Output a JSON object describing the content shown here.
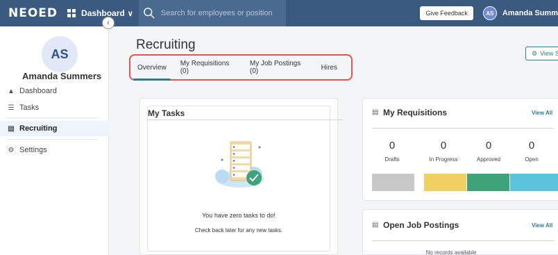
{
  "topbar": {
    "logo": "NEOED",
    "dashboard_label": "Dashboard",
    "search_placeholder": "Search for employees or positions",
    "feedback_label": "Give Feedback",
    "avatar_initials": "AS",
    "user_name": "Amanda Summ"
  },
  "sidebar": {
    "avatar_initials": "AS",
    "user_name": "Amanda Summers",
    "collapse_icon": "chevron-left-icon",
    "items": [
      {
        "label": "Dashboard",
        "icon": "home-icon"
      },
      {
        "label": "Tasks",
        "icon": "list-icon"
      },
      {
        "label": "Recruiting",
        "icon": "document-icon",
        "active": true
      },
      {
        "label": "Settings",
        "icon": "gear-icon"
      }
    ]
  },
  "main": {
    "title": "Recruiting",
    "tabs": [
      {
        "label": "Overview",
        "active": true
      },
      {
        "label": "My Requisitions (0)"
      },
      {
        "label": "My Job Postings (0)"
      },
      {
        "label": "Hires"
      }
    ],
    "view_button": "View S"
  },
  "tasks_card": {
    "title": "My Tasks",
    "message": "You have zero tasks to do!",
    "sub_message": "Check back later for any new tasks."
  },
  "requisitions_card": {
    "title": "My Requisitions",
    "view_all": "View All",
    "stats": [
      {
        "value": "0",
        "label": "Drafts",
        "color": "#c8c8c8"
      },
      {
        "value": "0",
        "label": "In Progress",
        "color": "#f2cf63"
      },
      {
        "value": "0",
        "label": "Approved",
        "color": "#3fa37a"
      },
      {
        "value": "0",
        "label": "Open",
        "color": "#5bc3dc"
      }
    ]
  },
  "postings_card": {
    "title": "Open Job Postings",
    "view_all": "View All",
    "empty_text": "No records available"
  },
  "colors": {
    "topbar": "#3a5a80",
    "accent": "#2f7d8a",
    "highlight_border": "#e05454"
  }
}
